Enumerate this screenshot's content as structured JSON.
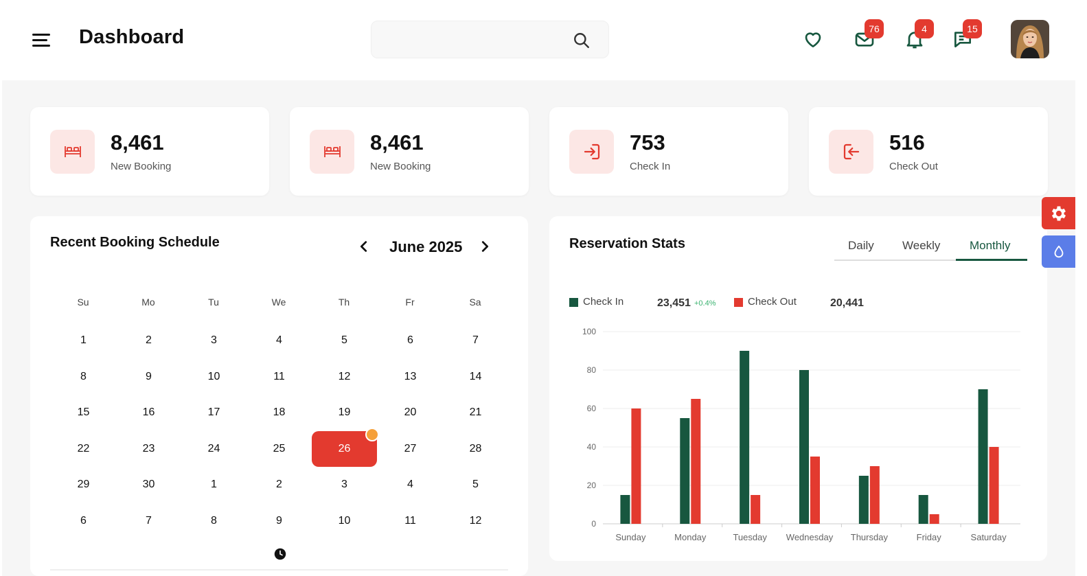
{
  "header": {
    "title": "Dashboard",
    "search": {
      "value": "",
      "placeholder": ""
    },
    "icons": [
      {
        "name": "heart-icon"
      },
      {
        "name": "mail-icon",
        "badge": "76"
      },
      {
        "name": "bell-icon",
        "badge": "4"
      },
      {
        "name": "chat-icon",
        "badge": "15"
      }
    ]
  },
  "stats": [
    {
      "icon": "bed-icon",
      "value": "8,461",
      "label": "New Booking"
    },
    {
      "icon": "bed-icon",
      "value": "8,461",
      "label": "New Booking"
    },
    {
      "icon": "check-in-icon",
      "value": "753",
      "label": "Check In"
    },
    {
      "icon": "check-out-icon",
      "value": "516",
      "label": "Check Out"
    }
  ],
  "calendar": {
    "title": "Recent Booking Schedule",
    "month": "June 2025",
    "weekdays": [
      "Su",
      "Mo",
      "Tu",
      "We",
      "Th",
      "Fr",
      "Sa"
    ],
    "weeks": [
      [
        "1",
        "2",
        "3",
        "4",
        "5",
        "6",
        "7"
      ],
      [
        "8",
        "9",
        "10",
        "11",
        "12",
        "13",
        "14"
      ],
      [
        "15",
        "16",
        "17",
        "18",
        "19",
        "20",
        "21"
      ],
      [
        "22",
        "23",
        "24",
        "25",
        "26",
        "27",
        "28"
      ],
      [
        "29",
        "30",
        "1",
        "2",
        "3",
        "4",
        "5"
      ],
      [
        "6",
        "7",
        "8",
        "9",
        "10",
        "11",
        "12"
      ]
    ],
    "selected": "26"
  },
  "reservation": {
    "title": "Reservation Stats",
    "tabs": [
      "Daily",
      "Weekly",
      "Monthly"
    ],
    "active_tab": "Monthly",
    "legend": {
      "check_in_label": "Check In",
      "check_in_value": "23,451",
      "check_in_delta": "+0.4%",
      "check_out_label": "Check Out",
      "check_out_value": "20,441"
    },
    "colors": {
      "check_in": "#17573f",
      "check_out": "#e33a2f"
    }
  },
  "chart_data": {
    "type": "bar",
    "categories": [
      "Sunday",
      "Monday",
      "Tuesday",
      "Wednesday",
      "Thursday",
      "Friday",
      "Saturday"
    ],
    "series": [
      {
        "name": "Check In",
        "values": [
          15,
          55,
          90,
          80,
          25,
          15,
          70
        ]
      },
      {
        "name": "Check Out",
        "values": [
          60,
          65,
          15,
          35,
          30,
          5,
          40
        ]
      }
    ],
    "yticks": [
      "0",
      "20",
      "40",
      "60",
      "80",
      "100"
    ],
    "ylim": [
      0,
      100
    ],
    "grid": true,
    "legend": "top-left"
  }
}
